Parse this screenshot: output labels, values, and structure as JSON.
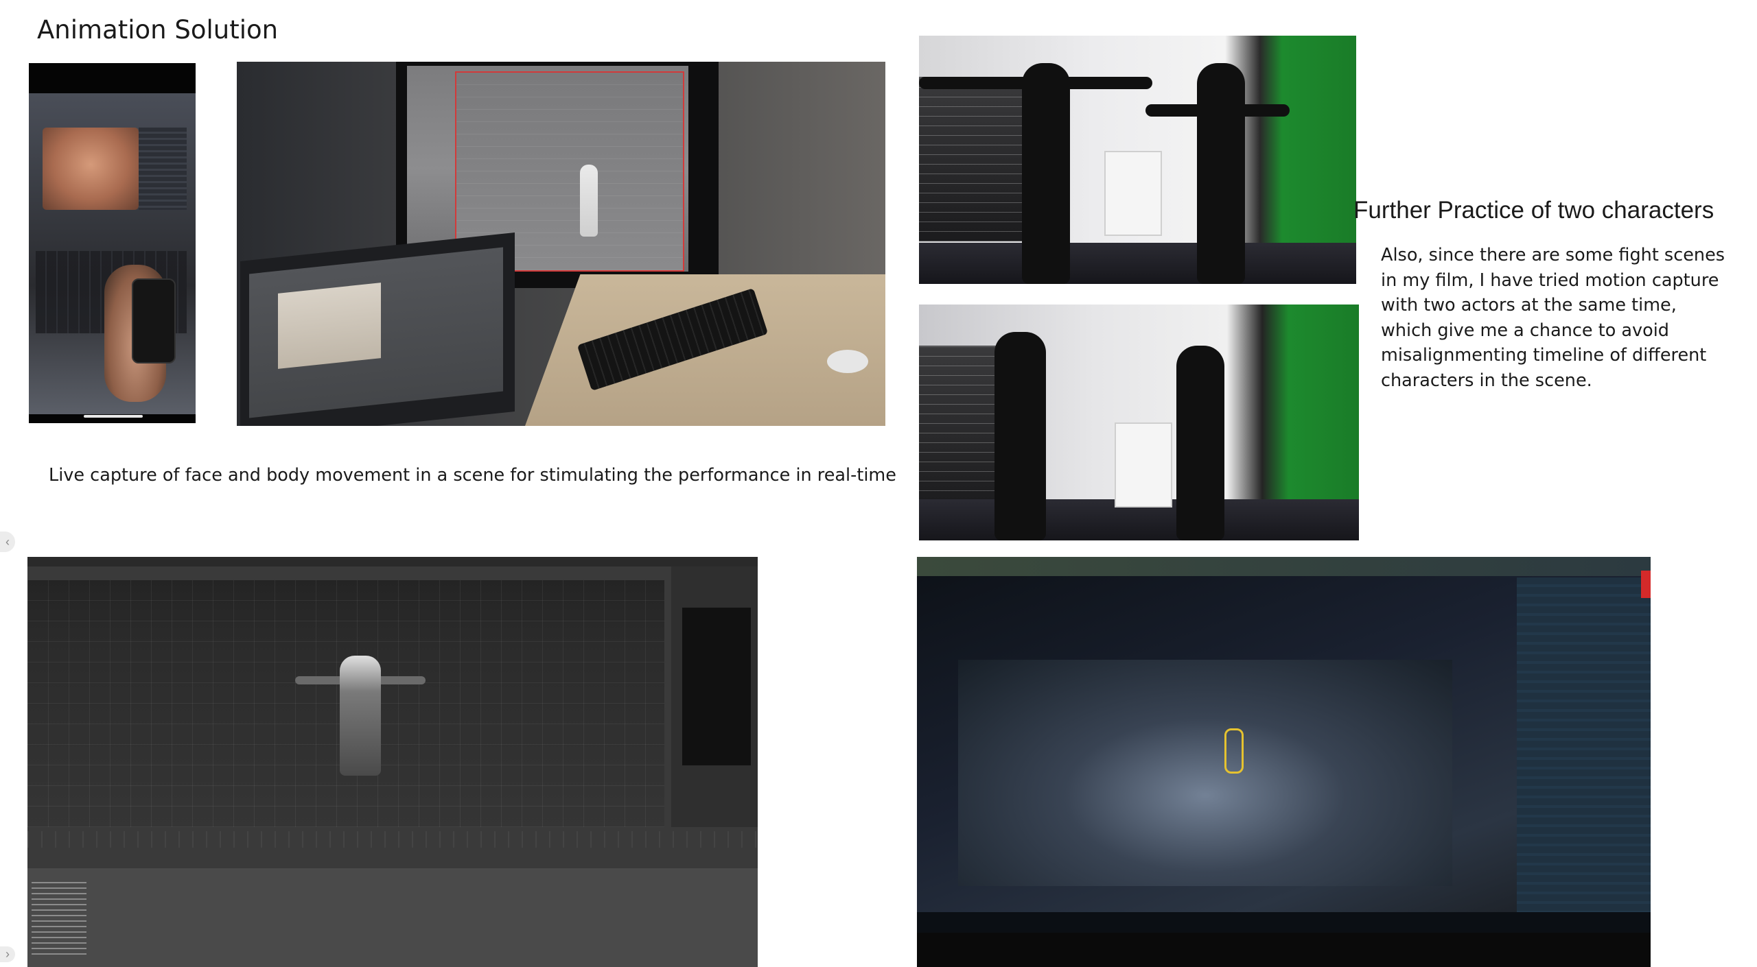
{
  "slide": {
    "title": "Animation Solution",
    "caption": "Live capture of face and body movement in a scene for stimulating the performance in real-time",
    "section_heading": "Further Practice of two characters",
    "paragraph_lines": [
      "Also, since there are some fight scenes",
      "in my film, I have tried motion capture",
      "with two actors at the same time,",
      "which give me a chance to avoid",
      "misalignmenting timeline of different",
      "characters in the scene."
    ]
  },
  "icons": {
    "prev_arrow": "chevron-left-icon",
    "next_arrow": "chevron-right-icon"
  },
  "colors": {
    "text": "#1a1a1a",
    "background": "#ffffff",
    "highlight_red": "#d23a3a",
    "green_screen": "#1d8a2e"
  }
}
